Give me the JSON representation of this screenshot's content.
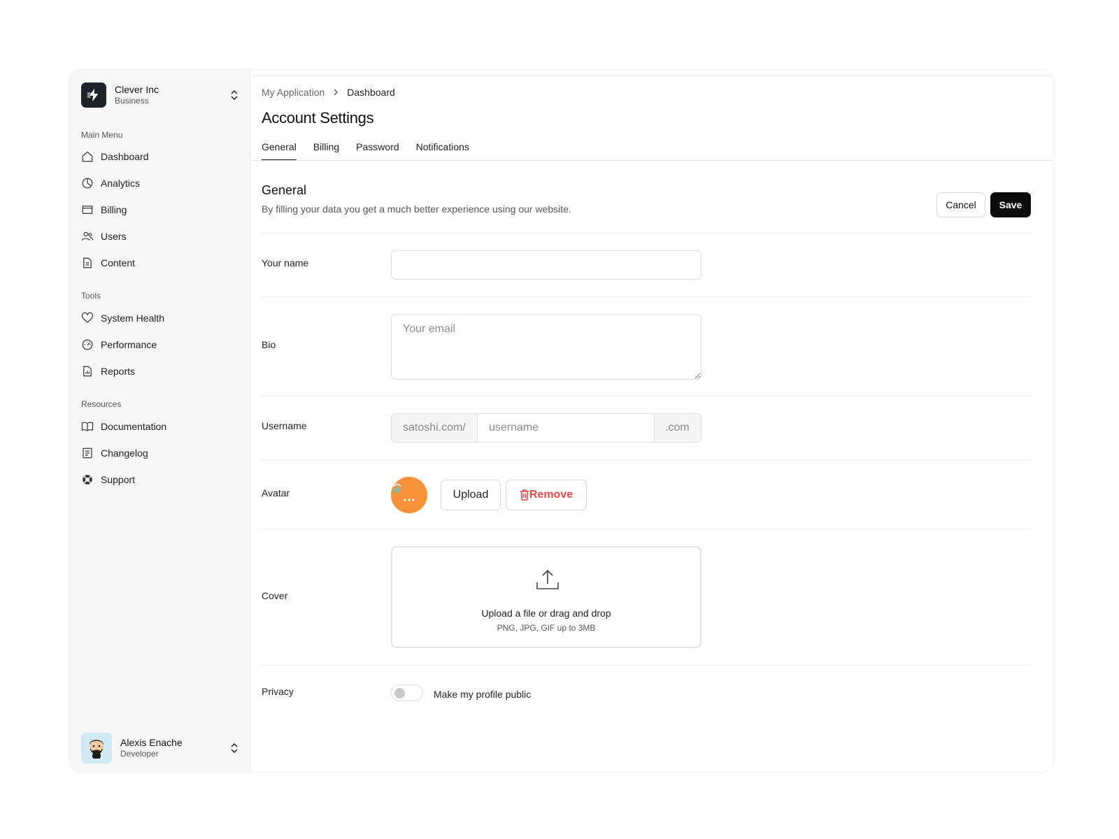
{
  "org": {
    "name": "Clever Inc",
    "plan": "Business",
    "logo_icon": "bolt-icon",
    "switcher_icon": "chevron-updown-icon"
  },
  "sidebar": {
    "sections": [
      {
        "label": "Main Menu",
        "items": [
          {
            "label": "Dashboard",
            "icon": "home-icon"
          },
          {
            "label": "Analytics",
            "icon": "pie-chart-icon"
          },
          {
            "label": "Billing",
            "icon": "credit-card-icon"
          },
          {
            "label": "Users",
            "icon": "users-icon"
          },
          {
            "label": "Content",
            "icon": "document-icon"
          }
        ]
      },
      {
        "label": "Tools",
        "items": [
          {
            "label": "System Health",
            "icon": "heart-icon"
          },
          {
            "label": "Performance",
            "icon": "gauge-icon"
          },
          {
            "label": "Reports",
            "icon": "report-icon"
          }
        ]
      },
      {
        "label": "Resources",
        "items": [
          {
            "label": "Documentation",
            "icon": "book-icon"
          },
          {
            "label": "Changelog",
            "icon": "list-icon"
          },
          {
            "label": "Support",
            "icon": "lifebuoy-icon"
          }
        ]
      }
    ]
  },
  "user": {
    "name": "Alexis Enache",
    "role": "Developer",
    "switcher_icon": "chevron-updown-icon"
  },
  "breadcrumb": {
    "parent": "My Application",
    "current": "Dashboard"
  },
  "page": {
    "title": "Account Settings"
  },
  "tabs": [
    {
      "label": "General",
      "active": true
    },
    {
      "label": "Billing",
      "active": false
    },
    {
      "label": "Password",
      "active": false
    },
    {
      "label": "Notifications",
      "active": false
    }
  ],
  "general": {
    "title": "General",
    "description": "By filling your data you get a much better experience using our website.",
    "cancel_label": "Cancel",
    "save_label": "Save"
  },
  "form": {
    "name": {
      "label": "Your name",
      "value": "",
      "placeholder": ""
    },
    "bio": {
      "label": "Bio",
      "value": "",
      "placeholder": "Your email"
    },
    "username": {
      "label": "Username",
      "prefix": "satoshi.com/",
      "placeholder": "username",
      "value": "",
      "suffix": ".com"
    },
    "avatar": {
      "label": "Avatar",
      "upload_label": "Upload",
      "remove_label": "Remove"
    },
    "cover": {
      "label": "Cover",
      "main_text": "Upload a file or drag and drop",
      "sub_text": "PNG, JPG, GIF up to 3MB",
      "icon": "upload-icon"
    },
    "privacy": {
      "label": "Privacy",
      "toggle_label": "Make my profile public",
      "enabled": false
    }
  },
  "colors": {
    "accent": "#0b0b0b",
    "danger": "#e5484d",
    "avatar_bg": "#f7923b",
    "sidebar_bg": "#f7f7f7"
  }
}
